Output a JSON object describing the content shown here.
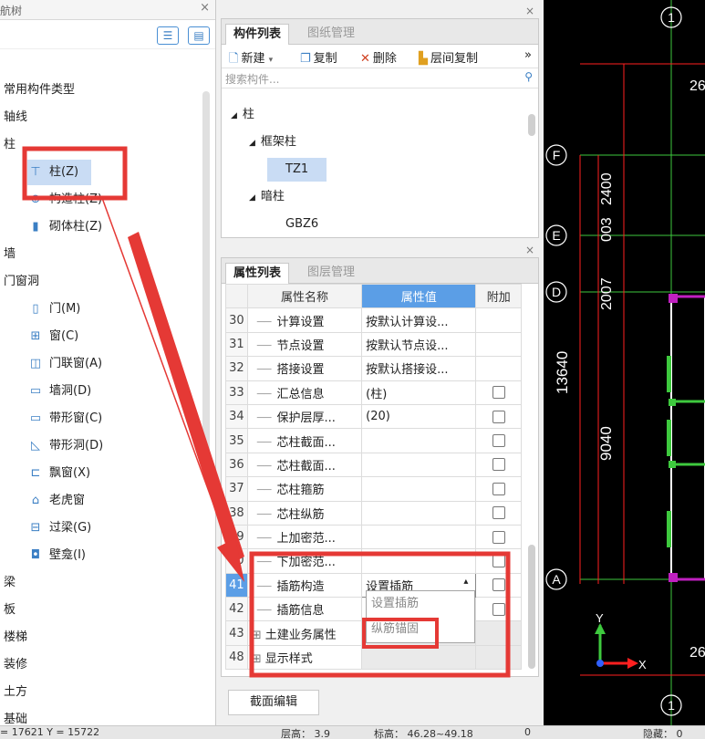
{
  "nav": {
    "title": "航树",
    "items": [
      {
        "label": "常用构件类型",
        "level": 0
      },
      {
        "label": "轴线",
        "level": 0
      },
      {
        "label": "柱",
        "level": 0
      },
      {
        "label": "柱(Z)",
        "level": 1,
        "selected": true
      },
      {
        "label": "构造柱(Z)",
        "level": 1
      },
      {
        "label": "砌体柱(Z)",
        "level": 1
      },
      {
        "label": "墙",
        "level": 0
      },
      {
        "label": "门窗洞",
        "level": 0
      },
      {
        "label": "门(M)",
        "level": 1
      },
      {
        "label": "窗(C)",
        "level": 1
      },
      {
        "label": "门联窗(A)",
        "level": 1
      },
      {
        "label": "墙洞(D)",
        "level": 1
      },
      {
        "label": "带形窗(C)",
        "level": 1
      },
      {
        "label": "带形洞(D)",
        "level": 1
      },
      {
        "label": "飘窗(X)",
        "level": 1
      },
      {
        "label": "老虎窗",
        "level": 1
      },
      {
        "label": "过梁(G)",
        "level": 1
      },
      {
        "label": "壁龛(I)",
        "level": 1
      },
      {
        "label": "梁",
        "level": 0
      },
      {
        "label": "板",
        "level": 0
      },
      {
        "label": "楼梯",
        "level": 0
      },
      {
        "label": "装修",
        "level": 0
      },
      {
        "label": "土方",
        "level": 0
      },
      {
        "label": "基础",
        "level": 0
      }
    ]
  },
  "components": {
    "tabs": [
      "构件列表",
      "图纸管理"
    ],
    "toolbar": {
      "new": "新建",
      "copy": "复制",
      "delete": "删除",
      "layer_copy": "层间复制",
      "more": "»"
    },
    "search_placeholder": "搜索构件...",
    "tree": [
      {
        "label": "柱",
        "level": 0,
        "expander": "◢"
      },
      {
        "label": "框架柱",
        "level": 1,
        "expander": "◢"
      },
      {
        "label": "TZ1",
        "level": 2,
        "selected": true
      },
      {
        "label": "暗柱",
        "level": 1,
        "expander": "◢"
      },
      {
        "label": "GBZ6",
        "level": 2
      }
    ]
  },
  "properties": {
    "tabs": [
      "属性列表",
      "图层管理"
    ],
    "headers": {
      "name": "属性名称",
      "value": "属性值",
      "extra": "附加"
    },
    "rows": [
      {
        "num": "30",
        "name": "计算设置",
        "value": "按默认计算设...",
        "check": false
      },
      {
        "num": "31",
        "name": "节点设置",
        "value": "按默认节点设...",
        "check": false
      },
      {
        "num": "32",
        "name": "搭接设置",
        "value": "按默认搭接设...",
        "check": false
      },
      {
        "num": "33",
        "name": "汇总信息",
        "value": "(柱)",
        "check": true
      },
      {
        "num": "34",
        "name": "保护层厚...",
        "value": "(20)",
        "check": true
      },
      {
        "num": "35",
        "name": "芯柱截面...",
        "value": "",
        "check": true
      },
      {
        "num": "36",
        "name": "芯柱截面...",
        "value": "",
        "check": true
      },
      {
        "num": "37",
        "name": "芯柱箍筋",
        "value": "",
        "check": true
      },
      {
        "num": "38",
        "name": "芯柱纵筋",
        "value": "",
        "check": true
      },
      {
        "num": "39",
        "name": "上加密范...",
        "value": "",
        "check": true
      },
      {
        "num": "40",
        "name": "下加密范...",
        "value": "",
        "check": true
      },
      {
        "num": "41",
        "name": "插筋构造",
        "value": "设置插筋",
        "check": true,
        "selected": true,
        "dropdown": true
      },
      {
        "num": "42",
        "name": "插筋信息",
        "value": "",
        "check": true
      },
      {
        "num": "43",
        "name": "土建业务属性",
        "value": "",
        "check": false,
        "group": true
      },
      {
        "num": "48",
        "name": "显示样式",
        "value": "",
        "check": false,
        "group": true
      }
    ],
    "dropdown_options": [
      "设置插筋",
      "纵筋锚固"
    ],
    "bottom_button": "截面编辑"
  },
  "cad": {
    "axis_labels": [
      "1",
      "F",
      "E",
      "D",
      "A",
      "1"
    ],
    "dims": [
      "26",
      "2400",
      "2007",
      "003",
      "13640",
      "9040",
      "26"
    ],
    "xaxis": "X",
    "yaxis": "Y"
  },
  "status": {
    "coords": "= 17621 Y = 15722",
    "floor_height": "层高：  3.9",
    "elevation": "标高：  46.28~49.18",
    "zero": "0",
    "hidden": "隐藏：  0"
  },
  "colors": {
    "highlight_red": "#e53935",
    "select_blue": "#5b9ee6",
    "cad_green": "#3ec93e",
    "cad_red": "#ff2020",
    "cad_magenta": "#c020c0"
  }
}
